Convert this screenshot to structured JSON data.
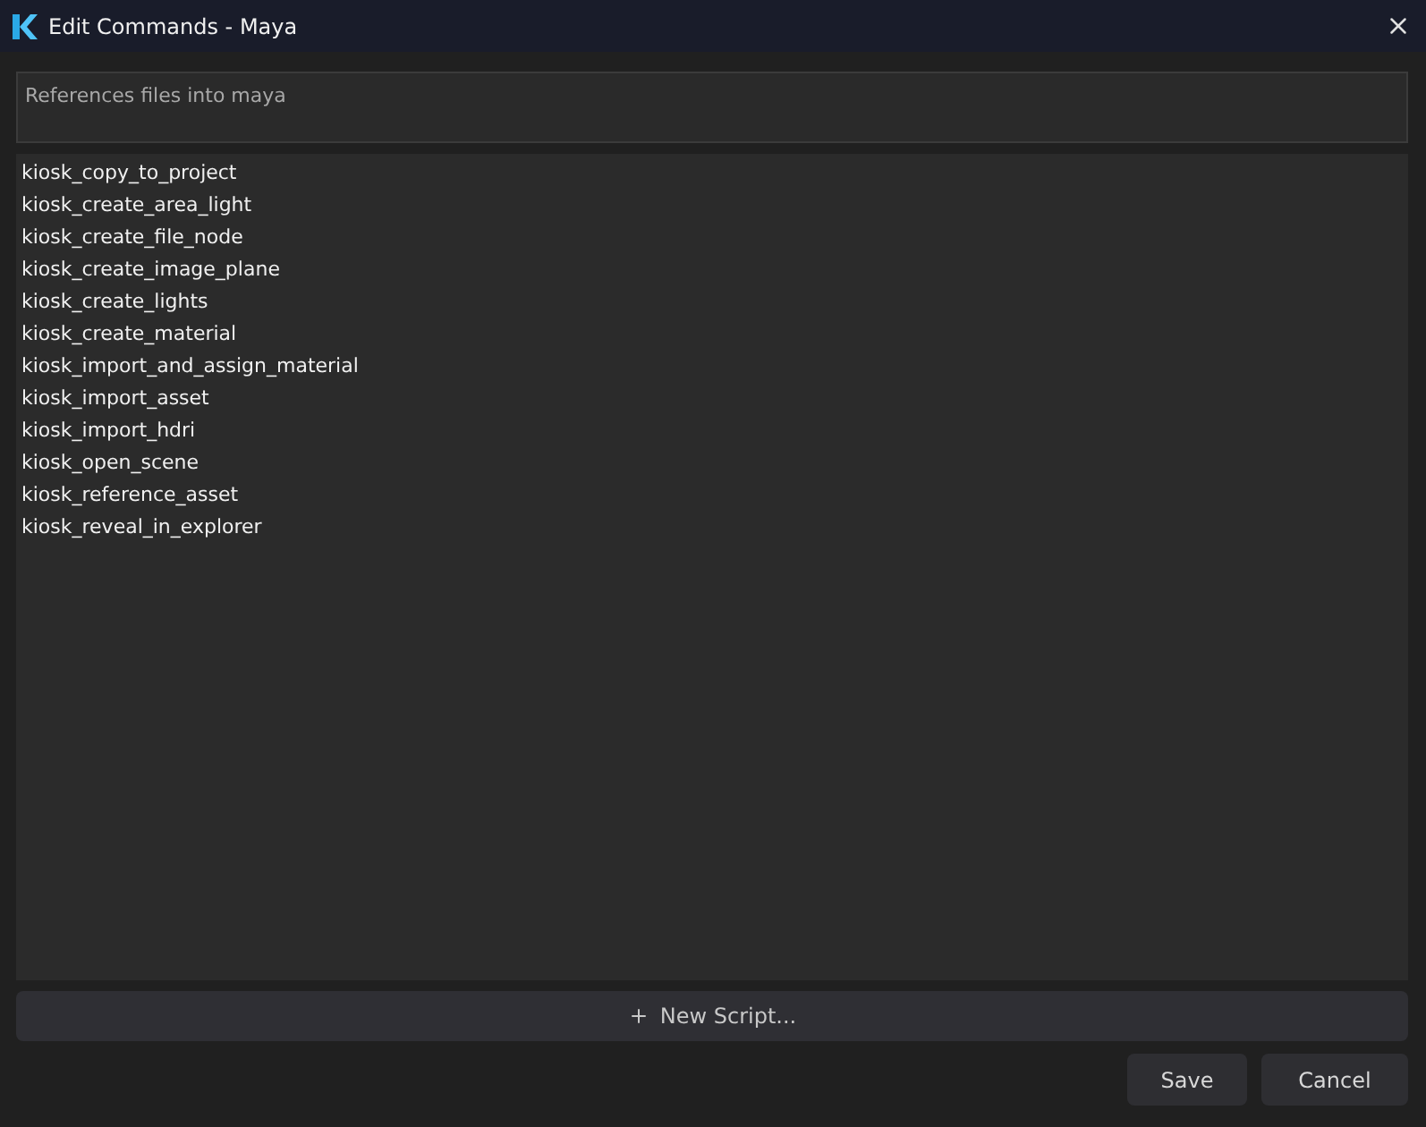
{
  "window": {
    "title": "Edit Commands - Maya"
  },
  "description": {
    "value": "References files into maya"
  },
  "commands": [
    {
      "label": "kiosk_copy_to_project"
    },
    {
      "label": "kiosk_create_area_light"
    },
    {
      "label": "kiosk_create_file_node"
    },
    {
      "label": "kiosk_create_image_plane"
    },
    {
      "label": "kiosk_create_lights"
    },
    {
      "label": "kiosk_create_material"
    },
    {
      "label": "kiosk_import_and_assign_material"
    },
    {
      "label": "kiosk_import_asset"
    },
    {
      "label": "kiosk_import_hdri"
    },
    {
      "label": "kiosk_open_scene"
    },
    {
      "label": "kiosk_reference_asset"
    },
    {
      "label": "kiosk_reveal_in_explorer"
    }
  ],
  "new_script_button": "New Script...",
  "buttons": [
    "Save",
    "Cancel"
  ]
}
